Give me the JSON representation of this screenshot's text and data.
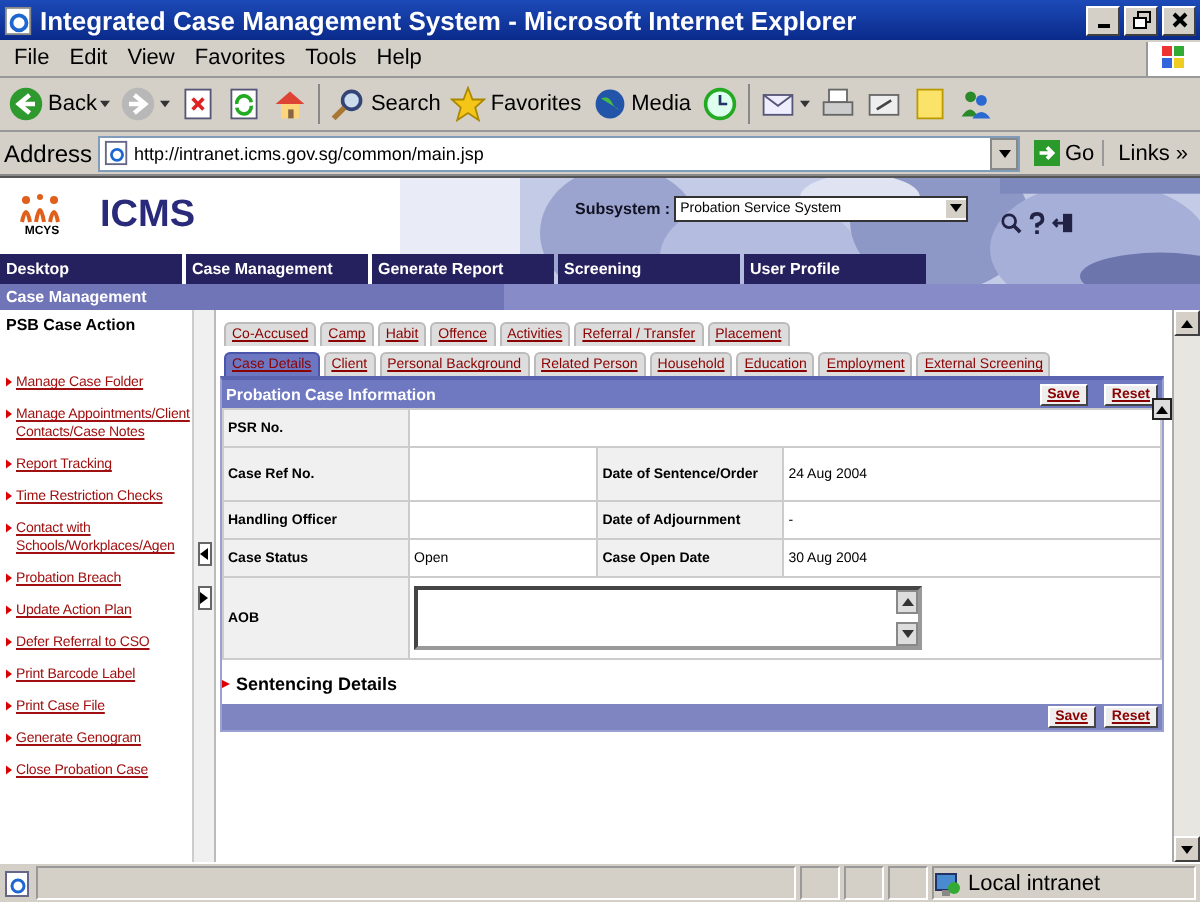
{
  "window": {
    "title": "Integrated Case Management System - Microsoft Internet Explorer"
  },
  "menu": [
    "File",
    "Edit",
    "View",
    "Favorites",
    "Tools",
    "Help"
  ],
  "toolbar": [
    {
      "kind": "back",
      "label": "Back",
      "dropdown": true
    },
    {
      "kind": "forward",
      "dropdown": true
    },
    {
      "kind": "stop"
    },
    {
      "kind": "refresh"
    },
    {
      "kind": "home"
    },
    {
      "kind": "search",
      "label": "Search"
    },
    {
      "kind": "favorites",
      "label": "Favorites"
    },
    {
      "kind": "media",
      "label": "Media"
    },
    {
      "kind": "history"
    },
    {
      "kind": "mail",
      "dropdown": true
    },
    {
      "kind": "print"
    },
    {
      "kind": "edit"
    },
    {
      "kind": "note"
    },
    {
      "kind": "messenger"
    }
  ],
  "address": {
    "label": "Address",
    "value": "http://intranet.icms.gov.sg/common/main.jsp",
    "go": "Go",
    "links": "Links",
    "links_more": "»"
  },
  "app": {
    "org": "MCYS",
    "name": "ICMS",
    "subsystem_label": "Subsystem :",
    "subsystem_value": "Probation Service System"
  },
  "nav": [
    "Desktop",
    "Case Management",
    "Generate Report",
    "Screening",
    "User Profile"
  ],
  "section_title": "Case Management",
  "sidebar": {
    "title": "PSB Case Action",
    "items": [
      "Manage Case Folder",
      "Manage Appointments/Client Contacts/Case Notes",
      "Report Tracking",
      "Time Restriction Checks",
      "Contact with Schools/Workplaces/Agen",
      "Probation Breach",
      "Update Action Plan",
      "Defer Referral to CSO",
      "Print Barcode Label",
      "Print Case File",
      "Generate Genogram",
      "Close Probation Case"
    ]
  },
  "tabs_row_1": [
    {
      "label": "Co-Accused",
      "selected": false
    },
    {
      "label": "Camp",
      "selected": false
    },
    {
      "label": "Habit",
      "selected": false
    },
    {
      "label": "Offence",
      "selected": false
    },
    {
      "label": "Activities",
      "selected": false
    },
    {
      "label": "Referral / Transfer",
      "selected": false
    },
    {
      "label": "Placement",
      "selected": false
    }
  ],
  "tabs_row_2": [
    {
      "label": "Case Details",
      "selected": true
    },
    {
      "label": "Client",
      "selected": false
    },
    {
      "label": "Personal Background",
      "selected": false
    },
    {
      "label": "Related Person",
      "selected": false
    },
    {
      "label": "Household",
      "selected": false
    },
    {
      "label": "Education",
      "selected": false
    },
    {
      "label": "Employment",
      "selected": false
    },
    {
      "label": "External Screening",
      "selected": false
    }
  ],
  "panel": {
    "title": "Probation Case Information",
    "save": "Save",
    "reset": "Reset",
    "rows": [
      {
        "cells": [
          {
            "label": "PSR No."
          }
        ]
      },
      {
        "cells": [
          {
            "label": "Case Ref No."
          },
          {
            "label": "Date of Sentence/Order",
            "value": "24 Aug 2004"
          }
        ]
      },
      {
        "cells": [
          {
            "label": "Handling Officer"
          },
          {
            "label": "Date of Adjournment",
            "value": "-"
          }
        ]
      },
      {
        "cells": [
          {
            "label": "Case Status",
            "value": "Open"
          },
          {
            "label": "Case Open Date",
            "value": "30 Aug 2004"
          }
        ]
      }
    ],
    "aob_label": "AOB"
  },
  "sentencing": {
    "title": "Sentencing Details",
    "expanded": false
  },
  "footer": {
    "save": "Save",
    "reset": "Reset"
  },
  "status_bar": {
    "zone": "Local intranet"
  }
}
